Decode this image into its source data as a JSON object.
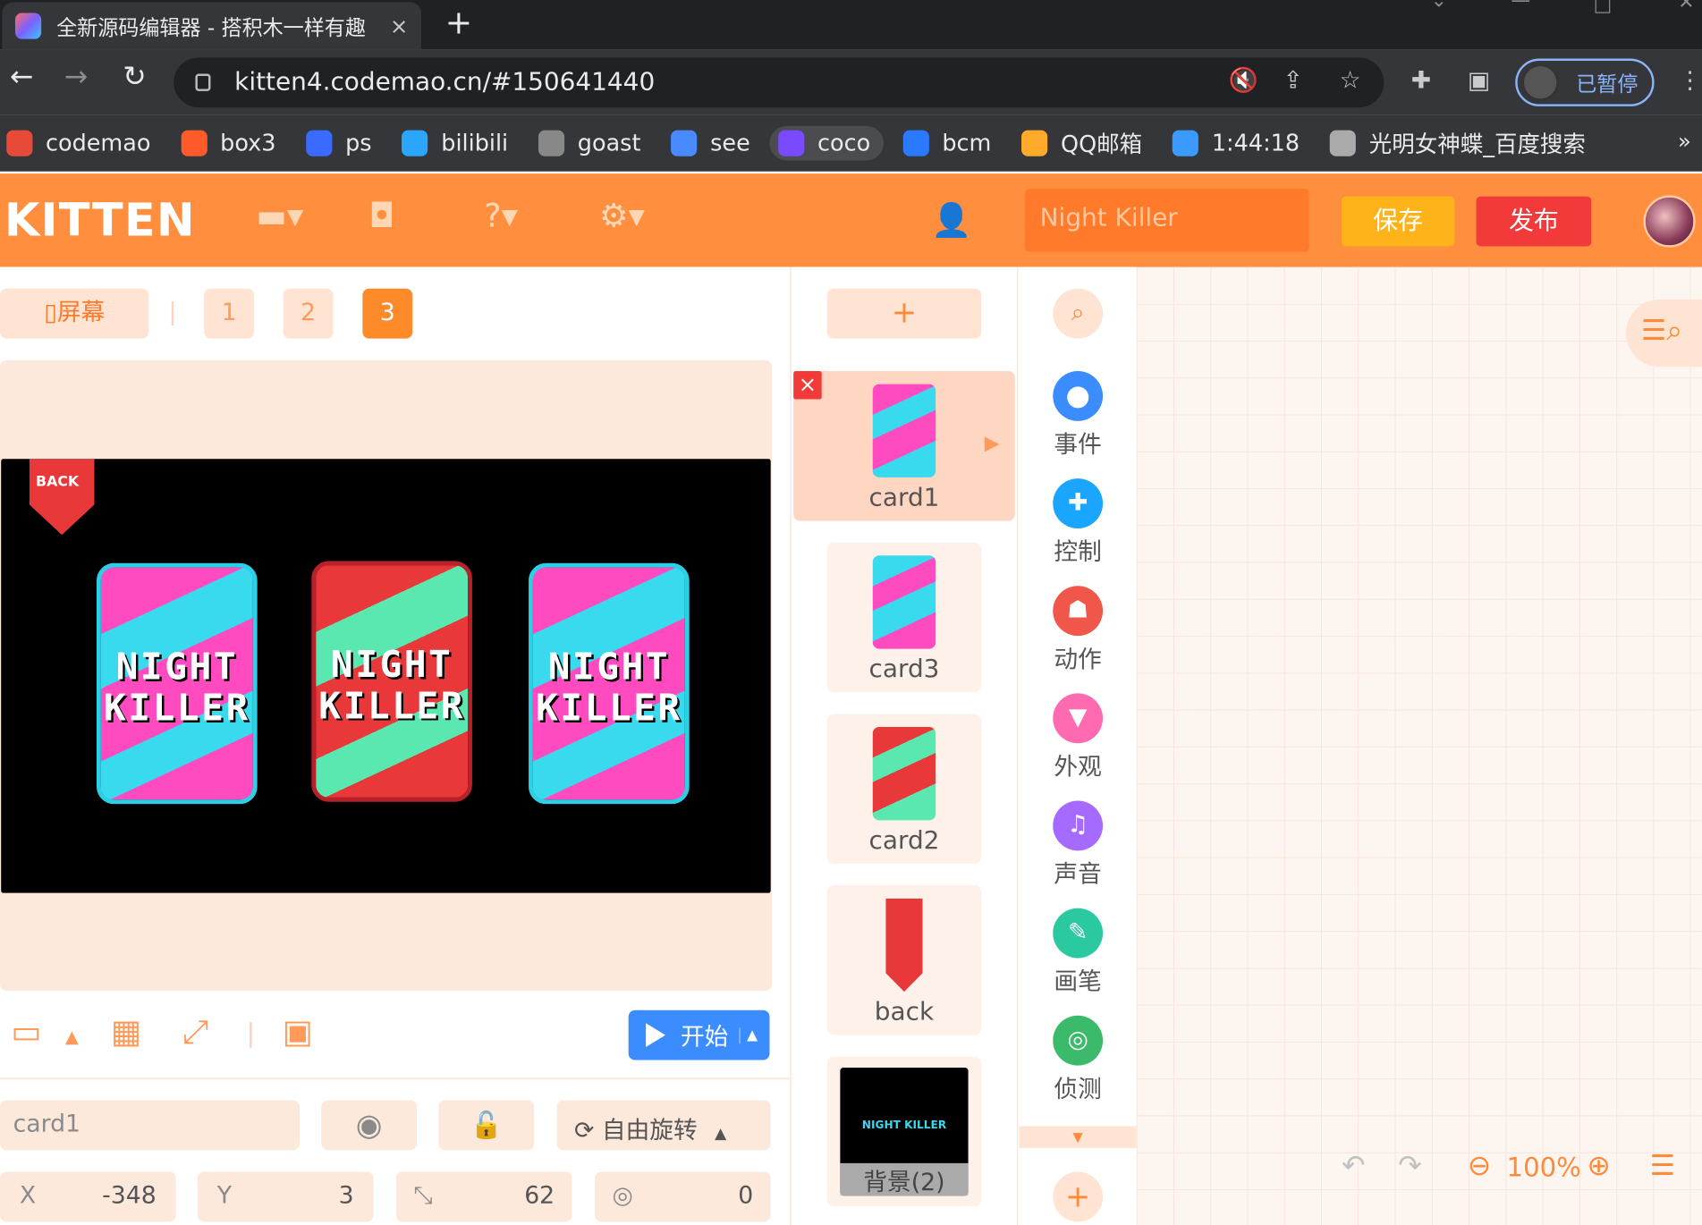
{
  "browser": {
    "tab_title": "全新源码编辑器 - 搭积木一样有趣",
    "tab_close": "×",
    "new_tab": "+",
    "url": "kitten4.codemao.cn/#150641440",
    "profile_status": "已暂停",
    "bookmarks": [
      {
        "label": "codemao",
        "color": "#e84a3a"
      },
      {
        "label": "box3",
        "color": "#ff5a2a"
      },
      {
        "label": "ps",
        "color": "#3a6aff"
      },
      {
        "label": "bilibili",
        "color": "#2aa6ff"
      },
      {
        "label": "goast",
        "color": "#888888"
      },
      {
        "label": "see",
        "color": "#4a8aff"
      },
      {
        "label": "coco",
        "color": "#7a4aff"
      },
      {
        "label": "bcm",
        "color": "#2a7aff"
      },
      {
        "label": "QQ邮箱",
        "color": "#ffaa2a"
      },
      {
        "label": "1:44:18",
        "color": "#3a9aff"
      },
      {
        "label": "光明女神蝶_百度搜索",
        "color": "#aaaaaa"
      }
    ],
    "bookmarks_more": "»"
  },
  "header": {
    "logo": "KITTEN",
    "project_name": "Night Killer",
    "save_label": "保存",
    "publish_label": "发布"
  },
  "stage": {
    "screen_label": "屏幕",
    "pages": [
      "1",
      "2",
      "3"
    ],
    "active_page": "3",
    "back_label": "BACK",
    "card_text_line1": "NIGHT",
    "card_text_line2": "KILLER",
    "start_label": "开始"
  },
  "properties": {
    "sprite_name": "card1",
    "rotation_label": "自由旋转",
    "x_label": "X",
    "x_value": "-348",
    "y_label": "Y",
    "y_value": "3",
    "size_value": "62",
    "direction_value": "0"
  },
  "sprites": {
    "add_label": "+",
    "items": [
      {
        "name": "card1"
      },
      {
        "name": "card3"
      },
      {
        "name": "card2"
      },
      {
        "name": "back"
      },
      {
        "name": "背景(2)"
      }
    ],
    "background_thumb_text": "NIGHT KILLER"
  },
  "categories": [
    {
      "label": "事件",
      "color": "#3a8cff"
    },
    {
      "label": "控制",
      "color": "#1aa6ff"
    },
    {
      "label": "动作",
      "color": "#f0574a"
    },
    {
      "label": "外观",
      "color": "#ff6ab0"
    },
    {
      "label": "声音",
      "color": "#a56aff"
    },
    {
      "label": "画笔",
      "color": "#2ac9a0"
    },
    {
      "label": "侦测",
      "color": "#3aba6a"
    }
  ],
  "workspace": {
    "zoom": "100%"
  }
}
